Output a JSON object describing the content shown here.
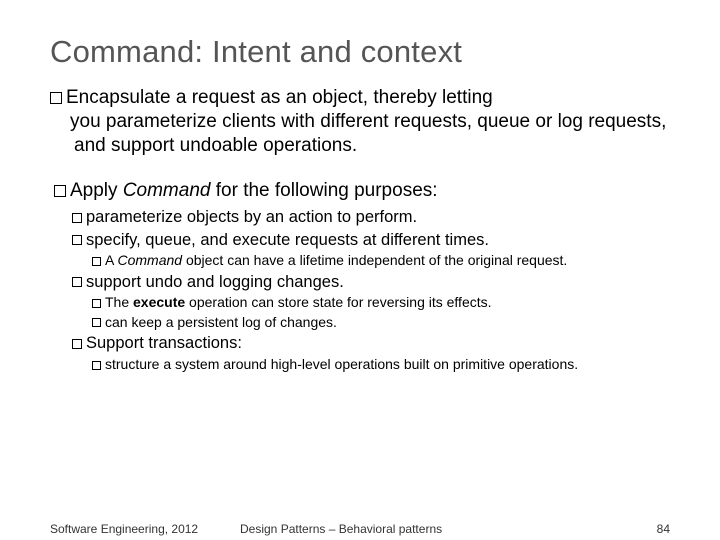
{
  "title": "Command: Intent and context",
  "b1_lead": "Encapsulate a request as an object, thereby letting",
  "b1_cont": "you parameterize clients with different requests, queue or log requests, and support undoable operations.",
  "b2_a": "Apply ",
  "b2_kw": "Command",
  "b2_b": " for the following purposes:",
  "s1": "parameterize objects by an action to perform.",
  "s2": "specify, queue, and execute requests at different times.",
  "s2_1a": "A ",
  "s2_1kw": "Command",
  "s2_1b": " object can have a lifetime independent of the original request.",
  "s3": "support undo and logging changes.",
  "s3_1a": "The ",
  "s3_1kw": "execute",
  "s3_1b": " operation can store state for reversing its effects.",
  "s3_2": "can keep a persistent log of changes.",
  "s4": "Support transactions:",
  "s4_1": "structure a system around high-level operations built on primitive operations.",
  "footer_left": "Software Engineering, 2012",
  "footer_center": "Design Patterns – Behavioral patterns",
  "footer_right": "84"
}
